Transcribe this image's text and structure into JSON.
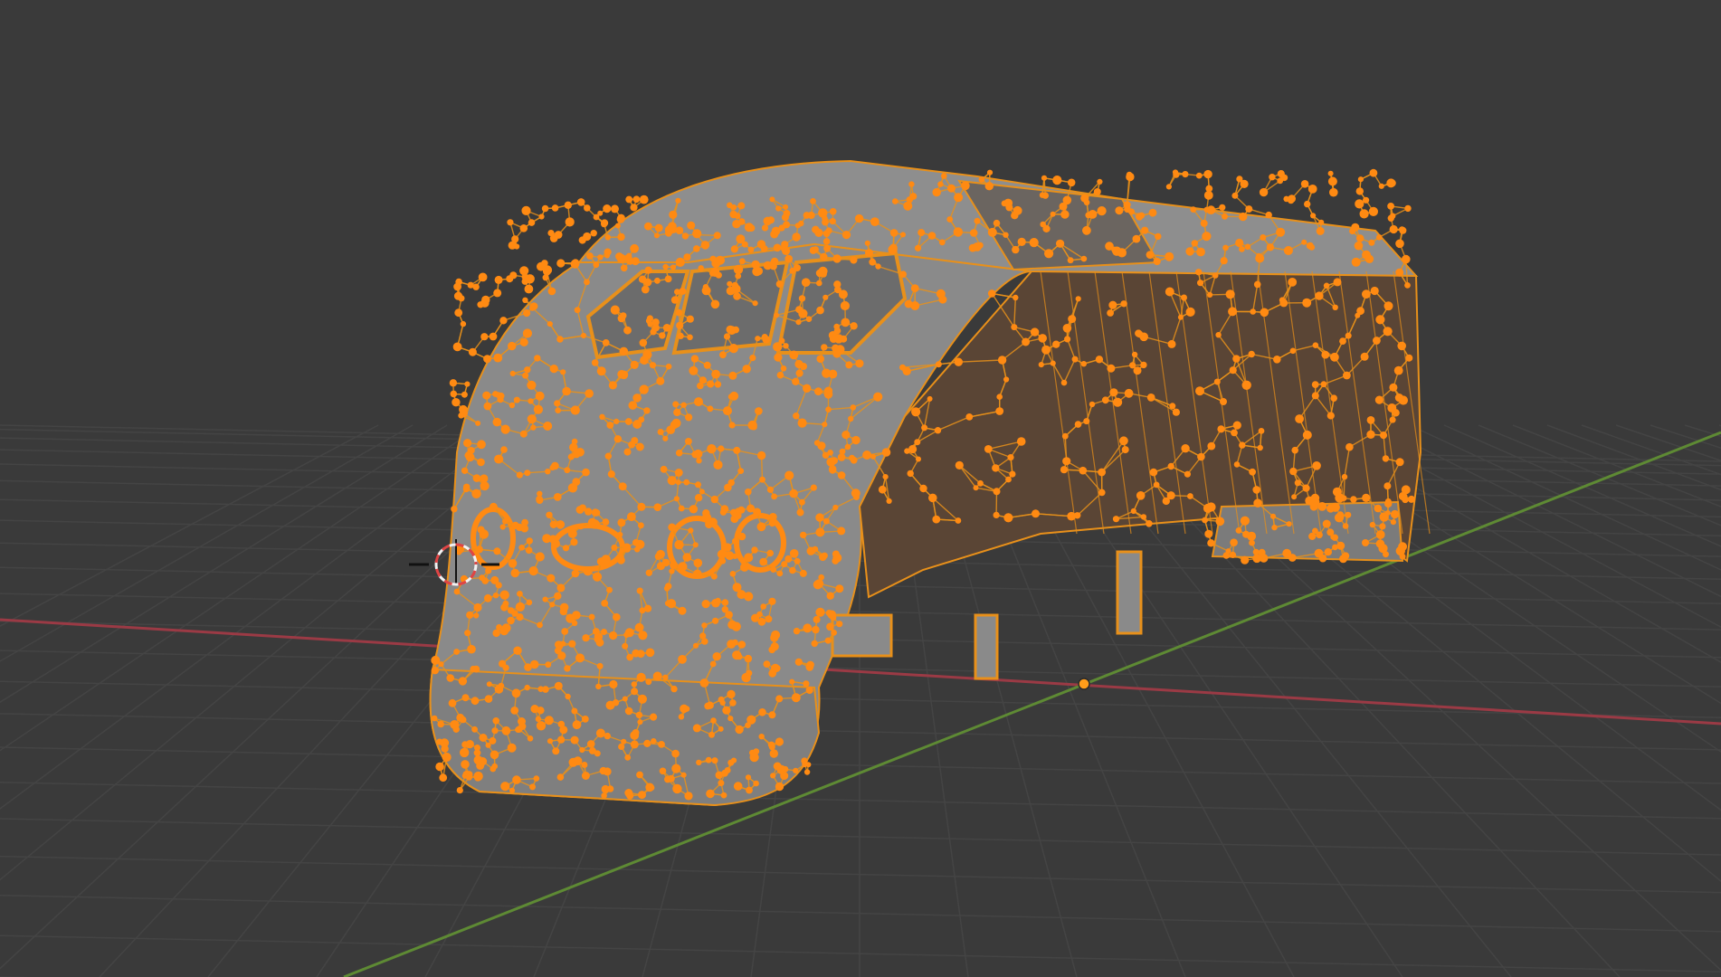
{
  "viewport": {
    "mode": "edit-mode",
    "shading": "solid",
    "selection": "all-vertices-selected"
  },
  "colors": {
    "background": "#3a3a3a",
    "grid_line": "#4a4a4a",
    "x_axis": "#9b3a45",
    "y_axis": "#5e8a34",
    "mesh_face": "#8c8c8c",
    "mesh_face_dark": "#5a4535",
    "selected_edge": "#e8901a",
    "selected_vertex": "#ff8a12",
    "origin": "#ff9d1a",
    "cursor_red": "#e04444",
    "cursor_white": "#f2f2f2"
  },
  "icons": {
    "3d_cursor": "3d-cursor-icon",
    "object_origin": "object-origin-icon"
  }
}
